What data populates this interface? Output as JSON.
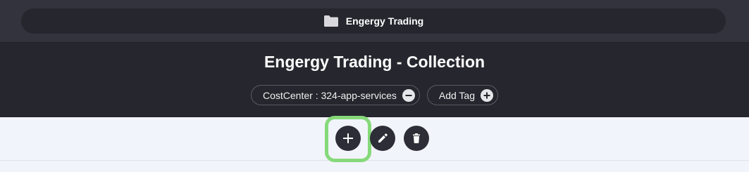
{
  "breadcrumb": {
    "icon": "folder-icon",
    "label": "Engergy Trading"
  },
  "header": {
    "title": "Engergy Trading - Collection"
  },
  "tags": [
    {
      "label": "CostCenter : 324-app-services",
      "action_icon": "minus-circle-icon"
    },
    {
      "label": "Add Tag",
      "action_icon": "plus-circle-icon"
    }
  ],
  "toolbar": {
    "actions": [
      {
        "name": "add",
        "icon": "plus-icon",
        "focused": true
      },
      {
        "name": "edit",
        "icon": "pencil-icon",
        "focused": false
      },
      {
        "name": "delete",
        "icon": "trash-icon",
        "focused": false
      }
    ]
  },
  "colors": {
    "top_bar": "#33333d",
    "header_bg": "#26262e",
    "toolbar_bg": "#f2f4fb",
    "focus_ring": "#86d97a",
    "button_bg": "#2d2d37"
  }
}
